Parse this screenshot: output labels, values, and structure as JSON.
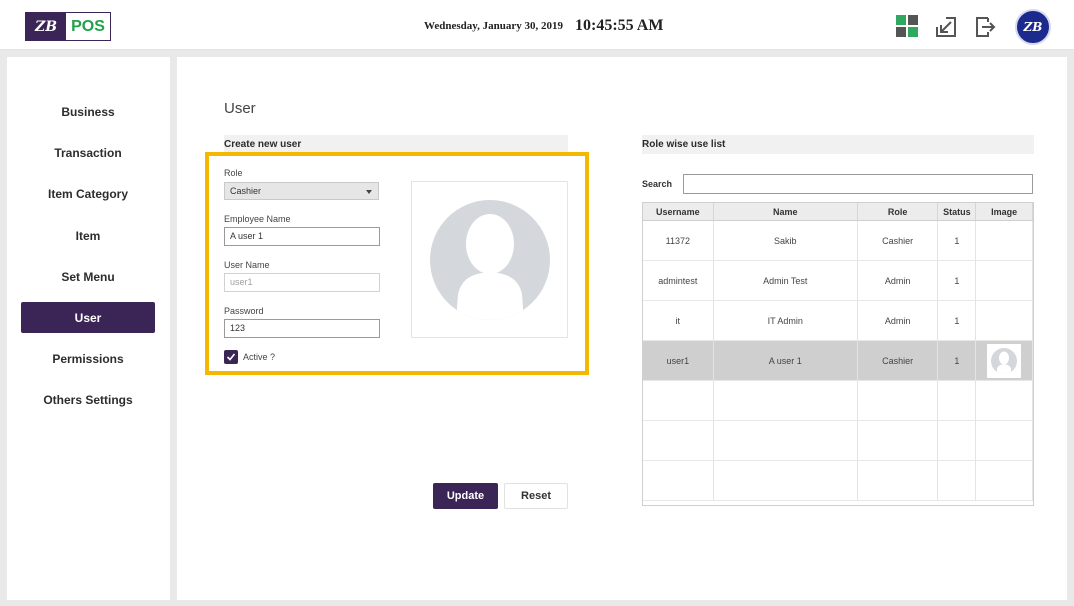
{
  "header": {
    "logo_mark": "ZB",
    "logo_text": "POS",
    "date": "Wednesday, January 30, 2019",
    "time": "10:45:55 AM",
    "avatar_initials": "ZB"
  },
  "sidebar": {
    "items": [
      {
        "label": "Business",
        "active": false
      },
      {
        "label": "Transaction",
        "active": false
      },
      {
        "label": "Item Category",
        "active": false
      },
      {
        "label": "Item",
        "active": false
      },
      {
        "label": "Set Menu",
        "active": false
      },
      {
        "label": "User",
        "active": true
      },
      {
        "label": "Permissions",
        "active": false
      },
      {
        "label": "Others Settings",
        "active": false
      }
    ]
  },
  "page": {
    "title": "User"
  },
  "form": {
    "section_title": "Create new user",
    "role_label": "Role",
    "role_value": "Cashier",
    "employee_name_label": "Employee Name",
    "employee_name_value": "A user 1",
    "user_name_label": "User Name",
    "user_name_value": "user1",
    "password_label": "Password",
    "password_value": "123",
    "active_label": "Active ?",
    "active_checked": true,
    "update_label": "Update",
    "reset_label": "Reset"
  },
  "list": {
    "section_title": "Role wise use list",
    "search_label": "Search",
    "search_value": "",
    "columns": [
      "Username",
      "Name",
      "Role",
      "Status",
      "Image"
    ],
    "rows": [
      {
        "username": "11372",
        "name": "Sakib",
        "role": "Cashier",
        "status": "1",
        "has_image": false,
        "selected": false
      },
      {
        "username": "admintest",
        "name": "Admin Test",
        "role": "Admin",
        "status": "1",
        "has_image": false,
        "selected": false
      },
      {
        "username": "it",
        "name": "IT Admin",
        "role": "Admin",
        "status": "1",
        "has_image": false,
        "selected": false
      },
      {
        "username": "user1",
        "name": "A user 1",
        "role": "Cashier",
        "status": "1",
        "has_image": true,
        "selected": true
      }
    ]
  },
  "colors": {
    "brand_purple": "#3a2556",
    "brand_green": "#1fa34a",
    "highlight_yellow": "#f5b800"
  }
}
